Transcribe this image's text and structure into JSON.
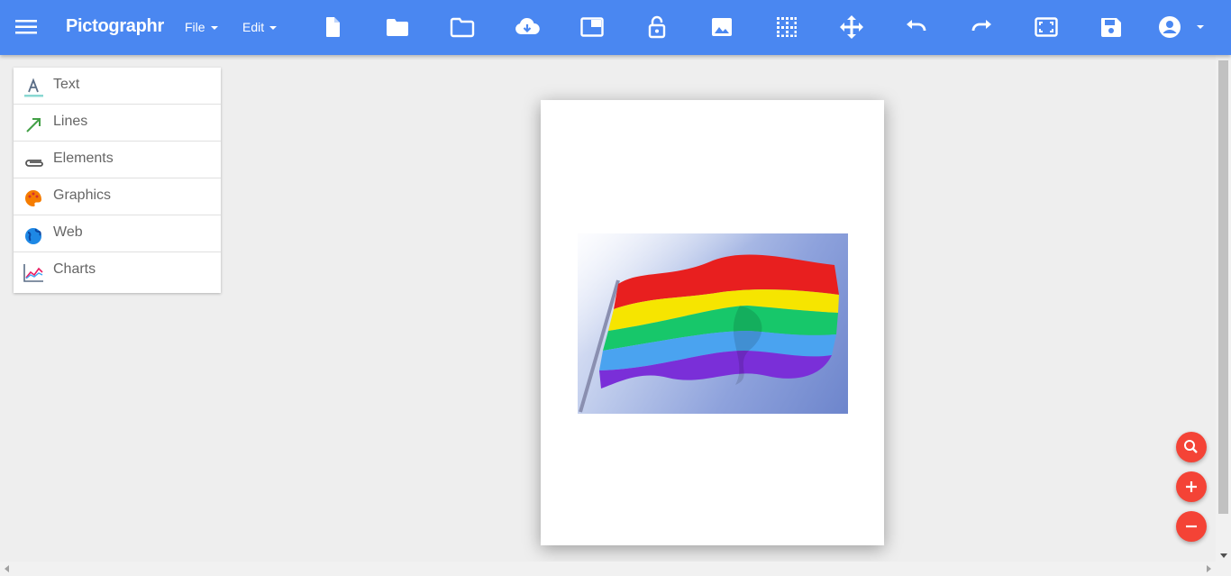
{
  "app": {
    "brand": "Pictographr",
    "accent_color": "#4a87f1",
    "fab_color": "#f44336"
  },
  "menus": {
    "file_label": "File",
    "edit_label": "Edit"
  },
  "toolbar": {
    "icons": [
      "new-document-icon",
      "open-folder-icon",
      "folder-outline-icon",
      "cloud-download-icon",
      "window-icon",
      "lock-open-icon",
      "image-icon",
      "grid-icon",
      "move-arrows-icon",
      "undo-icon",
      "redo-icon",
      "fit-screen-icon",
      "save-icon",
      "account-icon"
    ]
  },
  "sidebar": {
    "items": [
      {
        "label": "Text",
        "icon": "text-icon"
      },
      {
        "label": "Lines",
        "icon": "arrow-line-icon"
      },
      {
        "label": "Elements",
        "icon": "paperclip-icon"
      },
      {
        "label": "Graphics",
        "icon": "palette-icon"
      },
      {
        "label": "Web",
        "icon": "globe-icon"
      },
      {
        "label": "Charts",
        "icon": "line-chart-icon"
      }
    ]
  },
  "canvas": {
    "image_subject": "rainbow flag"
  },
  "fabs": [
    "search-icon",
    "zoom-in-icon",
    "zoom-out-icon"
  ]
}
